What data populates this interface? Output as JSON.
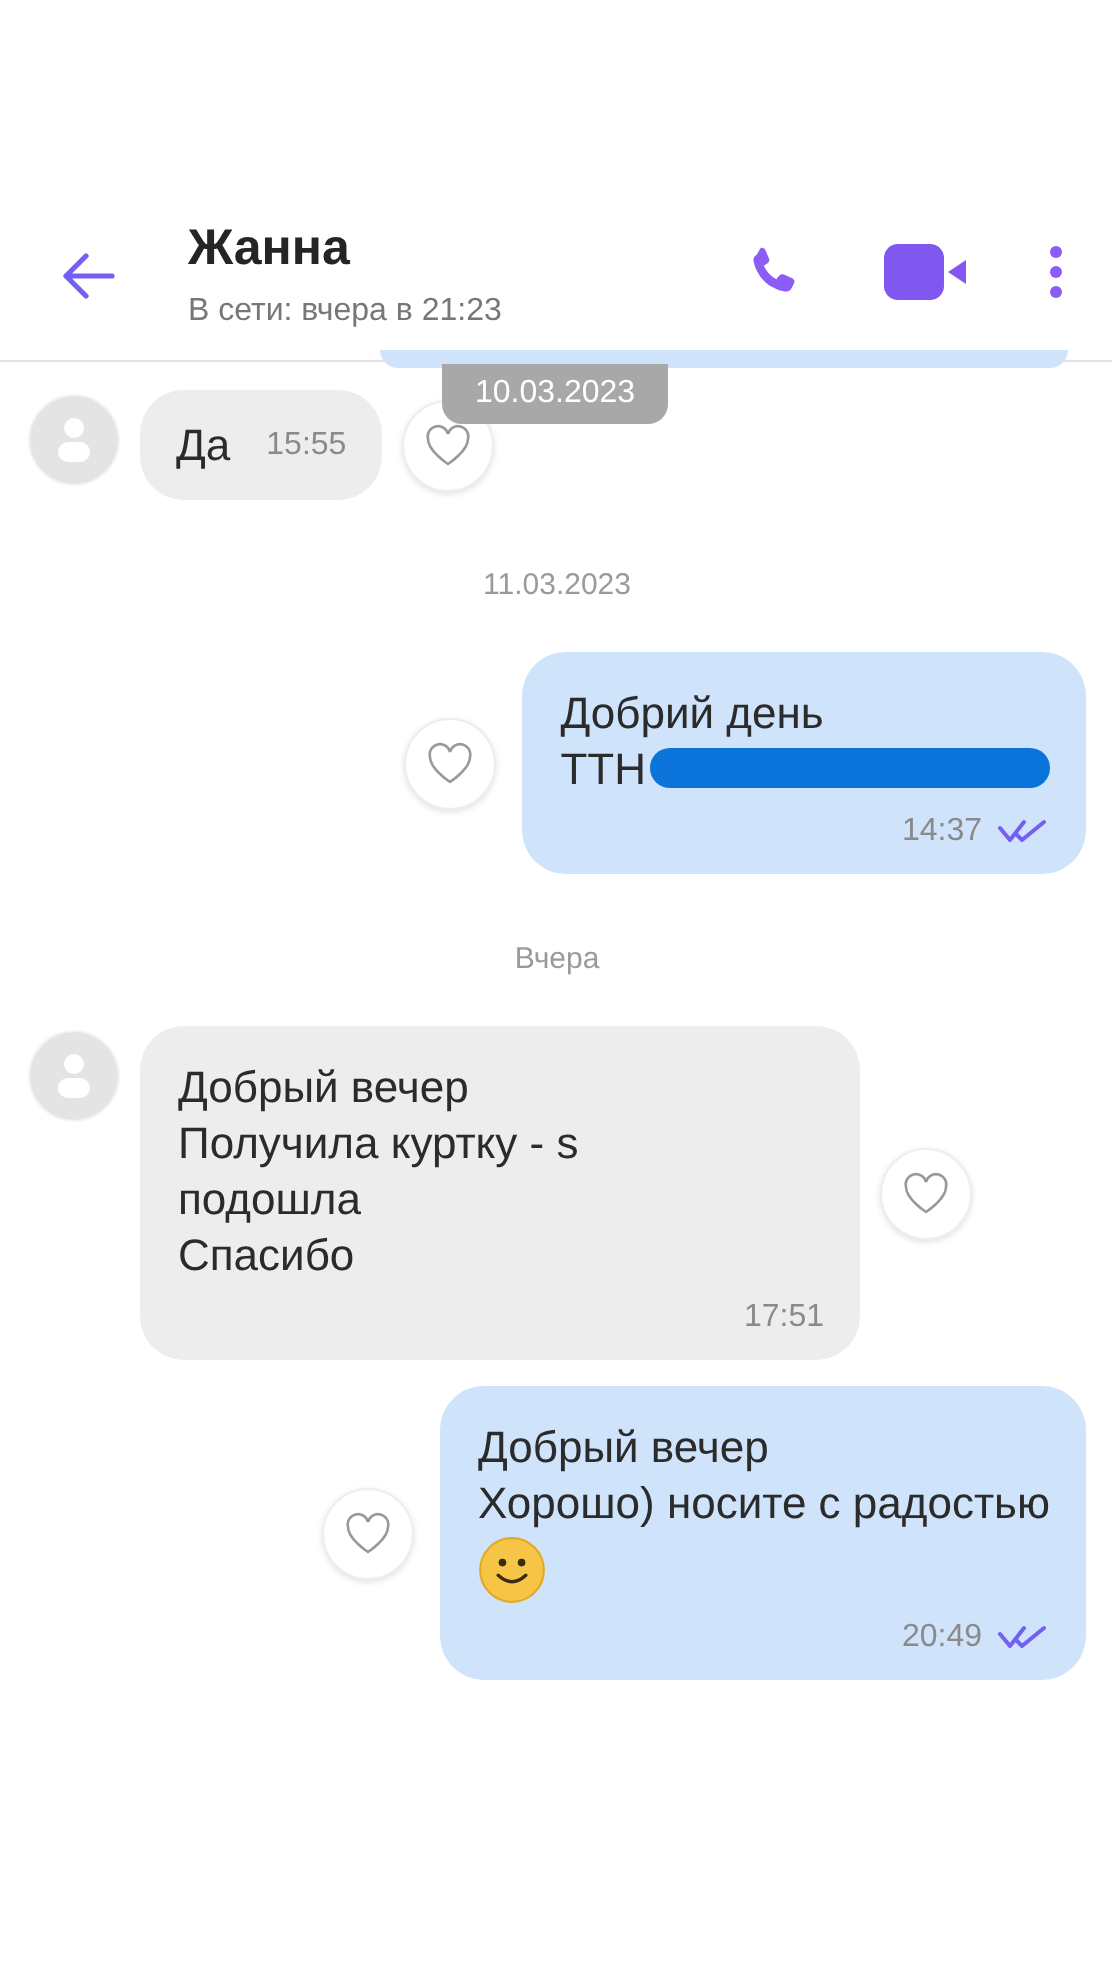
{
  "header": {
    "name": "Жанна",
    "status": "В сети: вчера в 21:23"
  },
  "floating_date": "10.03.2023",
  "messages": [
    {
      "kind": "incoming",
      "text": "Да",
      "time": "15:55"
    },
    {
      "kind": "date",
      "text": "11.03.2023"
    },
    {
      "kind": "outgoing",
      "text": "Добрий день\nТТН",
      "redacted": true,
      "time": "14:37",
      "read": true
    },
    {
      "kind": "date",
      "text": "Вчера"
    },
    {
      "kind": "incoming",
      "text": "Добрый вечер\nПолучила куртку - s\nподошла\nСпасибо",
      "time": "17:51"
    },
    {
      "kind": "outgoing",
      "text": "Добрый вечер\nХорошо) носите с радостью",
      "smiley": true,
      "time": "20:49",
      "read": true
    }
  ]
}
